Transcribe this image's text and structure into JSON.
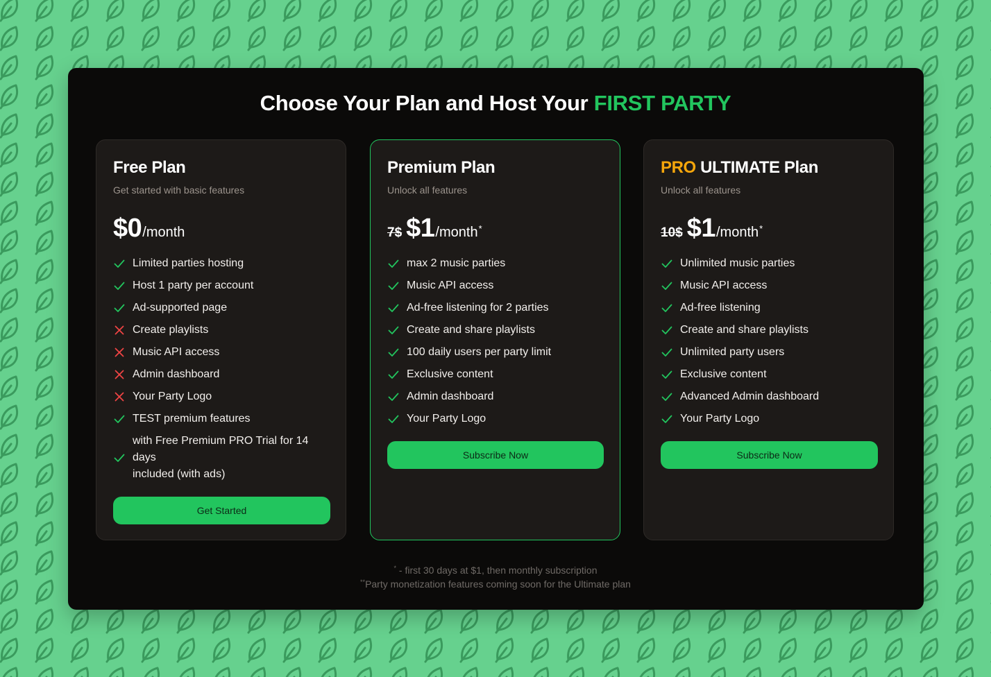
{
  "theme": {
    "page_background": "#66d18e",
    "pattern_stroke": "#3a9a5d",
    "panel_background": "#0b0a09",
    "card_background": "#1d1a18",
    "accent_green": "#22c55e",
    "accent_gold": "#f5a60b",
    "cross_red": "#ef4444"
  },
  "background": {
    "icon": "leaf-icon"
  },
  "header": {
    "title_prefix": "Choose Your Plan and Host Your ",
    "title_highlight": "FIRST PARTY"
  },
  "plans": [
    {
      "title": "Free Plan",
      "subtitle": "Get started with basic features",
      "price_old": "",
      "price_amount": "$0",
      "price_period": "/month",
      "price_note": "",
      "features": [
        {
          "text": "Limited parties hosting",
          "included": true
        },
        {
          "text": "Host 1 party per account",
          "included": true
        },
        {
          "text": "Ad-supported page",
          "included": true
        },
        {
          "text": "Create playlists",
          "included": false
        },
        {
          "text": "Music API access",
          "included": false
        },
        {
          "text": "Admin dashboard",
          "included": false
        },
        {
          "text": "Your Party Logo",
          "included": false
        },
        {
          "text": "TEST premium features",
          "included": true
        },
        {
          "text": "with Free Premium PRO Trial for 14 days\nincluded (with ads)",
          "included": true
        }
      ],
      "button_label": "Get Started"
    },
    {
      "title": "Premium Plan",
      "subtitle": "Unlock all features",
      "price_old": "7$",
      "price_amount": "$1",
      "price_period": "/month",
      "price_note": "*",
      "features": [
        {
          "text": "max 2 music parties",
          "included": true
        },
        {
          "text": "Music API access",
          "included": true
        },
        {
          "text": "Ad-free listening for 2 parties",
          "included": true
        },
        {
          "text": "Create and share playlists",
          "included": true
        },
        {
          "text": "100 daily users per party limit",
          "included": true
        },
        {
          "text": "Exclusive content",
          "included": true
        },
        {
          "text": "Admin dashboard",
          "included": true
        },
        {
          "text": "Your Party Logo",
          "included": true
        }
      ],
      "button_label": "Subscribe Now"
    },
    {
      "title_highlight": "PRO",
      "title": "ULTIMATE Plan",
      "subtitle": "Unlock all features",
      "price_old": "10$",
      "price_amount": "$1",
      "price_period": "/month",
      "price_note": "*",
      "features": [
        {
          "text": "Unlimited music parties",
          "included": true
        },
        {
          "text": "Music API access",
          "included": true
        },
        {
          "text": "Ad-free listening",
          "included": true
        },
        {
          "text": "Create and share playlists",
          "included": true
        },
        {
          "text": "Unlimited party users",
          "included": true
        },
        {
          "text": "Exclusive content",
          "included": true
        },
        {
          "text": "Advanced Admin dashboard",
          "included": true
        },
        {
          "text": "Your Party Logo",
          "included": true
        }
      ],
      "button_label": "Subscribe Now"
    }
  ],
  "footnotes": [
    {
      "marker": "*",
      "text": " - first 30 days at $1, then monthly subscription"
    },
    {
      "marker": "**",
      "text": "Party monetization features coming soon for the Ultimate plan"
    }
  ]
}
